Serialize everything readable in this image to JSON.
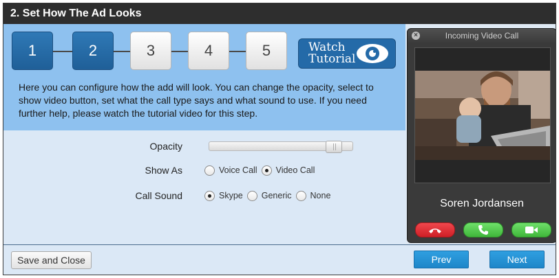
{
  "header": {
    "title": "2. Set How The Ad Looks"
  },
  "steps": [
    {
      "label": "1",
      "state": "active"
    },
    {
      "label": "2",
      "state": "active"
    },
    {
      "label": "3",
      "state": "inactive"
    },
    {
      "label": "4",
      "state": "inactive"
    },
    {
      "label": "5",
      "state": "inactive"
    }
  ],
  "tutorial_button": {
    "line1": "Watch",
    "line2": "Tutorial",
    "icon": "eye-icon"
  },
  "description": "Here you can configure how the add will look. You can change the opacity, select to show video button, set what the call type says and what sound to use. If you need further help, please watch the tutorial video for this step.",
  "settings": {
    "opacity": {
      "label": "Opacity",
      "value_fraction": 0.92
    },
    "show_as": {
      "label": "Show As",
      "options": [
        {
          "label": "Voice Call",
          "checked": false
        },
        {
          "label": "Video Call",
          "checked": true
        }
      ]
    },
    "call_sound": {
      "label": "Call Sound",
      "options": [
        {
          "label": "Skype",
          "checked": true
        },
        {
          "label": "Generic",
          "checked": false
        },
        {
          "label": "None",
          "checked": false
        }
      ]
    }
  },
  "call_preview": {
    "title": "Incoming Video Call",
    "close_icon": "close-icon",
    "caller_name": "Soren Jordansen",
    "buttons": [
      {
        "name": "decline",
        "icon": "phone-hangup-icon",
        "color": "#e0262c"
      },
      {
        "name": "answer-voice",
        "icon": "phone-icon",
        "color": "#47c342"
      },
      {
        "name": "answer-video",
        "icon": "video-camera-icon",
        "color": "#47c342"
      }
    ]
  },
  "footer": {
    "save_label": "Save and Close",
    "prev_label": "Prev",
    "next_label": "Next"
  },
  "colors": {
    "accent_blue": "#1f6fae",
    "top_panel": "#8ec1ef",
    "bottom_panel": "#dbe8f6",
    "titlebar": "#2e2e2e"
  }
}
